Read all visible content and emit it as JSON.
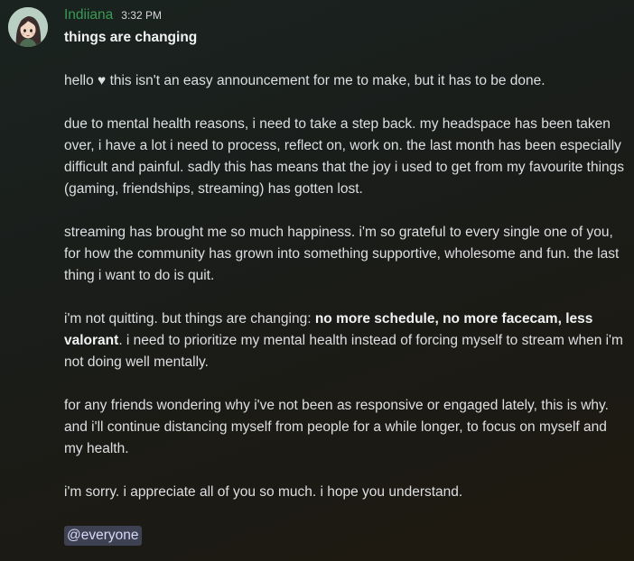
{
  "message": {
    "username": "Indiiana",
    "timestamp": "3:32 PM",
    "title": "things are changing",
    "p1": "hello ♥ this isn't an easy announcement for me to make, but it has to be done.",
    "p2": "due to mental health reasons, i need to take a step back. my headspace has been taken over, i have a lot i need to process, reflect on, work on. the last month has been especially difficult and painful. sadly this has means that the joy i used to get from my favourite things (gaming, friendships, streaming) has gotten lost.",
    "p3": "streaming has brought me so much happiness. i'm so grateful to every single one of you, for how the community has grown into something supportive, wholesome and fun. the last thing i want to do is quit.",
    "p4_start": "i'm not quitting. but things are changing: ",
    "p4_bold": "no more schedule, no more facecam, less valorant",
    "p4_end": ". i need to prioritize my mental health instead of forcing myself to stream when i'm not doing well mentally.",
    "p5": "for any friends wondering why i've not been as responsive or engaged lately, this is why. and i'll continue distancing myself from people for a while longer, to focus on myself and my health.",
    "p6": "i'm sorry. i appreciate all of you so much. i hope you understand.",
    "mention": "@everyone"
  },
  "colors": {
    "username": "#3a9a55",
    "mention_bg": "#3d4152",
    "mention_text": "#d5d8f7"
  },
  "icons": {
    "avatar": "user-avatar-illustration"
  }
}
